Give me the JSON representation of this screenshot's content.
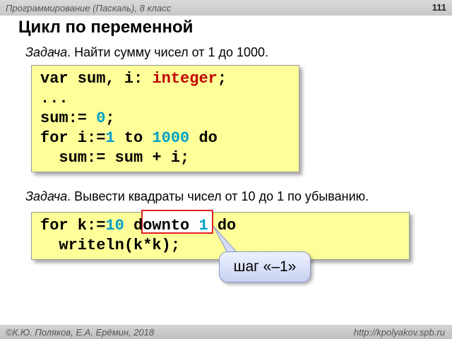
{
  "header": {
    "course": "Программирование (Паскаль), 8 класс",
    "page_number": "111"
  },
  "slide": {
    "title": "Цикл по переменной"
  },
  "task1": {
    "label": "Задача",
    "text": ". Найти сумму чисел от 1 до 1000."
  },
  "code1": {
    "line1": {
      "a": "var sum, i: ",
      "b": "integer",
      "c": ";"
    },
    "line2": "...",
    "line3": {
      "a": "sum:= ",
      "b": "0",
      "c": ";"
    },
    "line4": {
      "a": "for i:=",
      "b": "1",
      "c": " to ",
      "d": "1000",
      "e": " do"
    },
    "line5": "  sum:= sum + i;"
  },
  "task2": {
    "label": "Задача",
    "text": ". Вывести квадраты чисел от 10 до 1 по убыванию."
  },
  "code2": {
    "line1": {
      "a": "for k:=",
      "b": "10",
      "c": " ",
      "d": "downto",
      "e": " ",
      "f": "1",
      "g": " do"
    },
    "line2": "  writeln(k*k);"
  },
  "callout": {
    "text": "шаг «–1»"
  },
  "footer": {
    "author": "©К.Ю. Поляков, Е.А. Ерёмин, 2018",
    "url": "http://kpolyakov.spb.ru"
  },
  "colors": {
    "code_bg": "#ffff99",
    "keyword_red": "#c00000",
    "number_cyan": "#00a0c8",
    "highlight_border": "#e02020"
  }
}
